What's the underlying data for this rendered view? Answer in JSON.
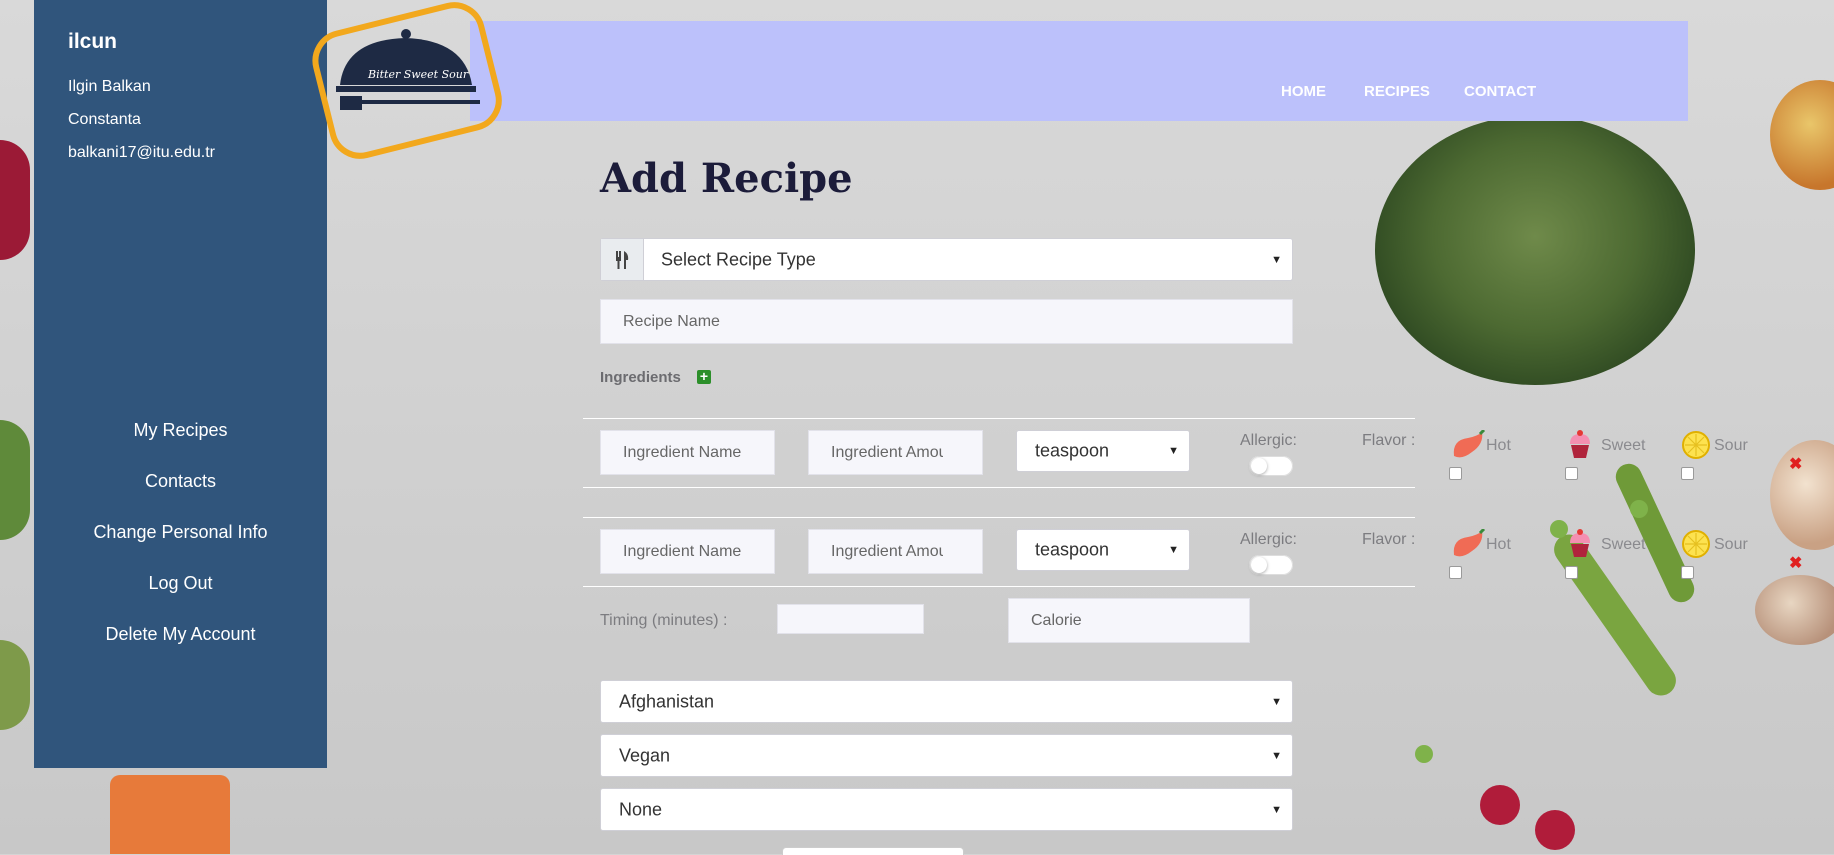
{
  "sidebar": {
    "username": "ilcun",
    "full_name": "Ilgin Balkan",
    "city": "Constanta",
    "email": "balkani17@itu.edu.tr",
    "menu": [
      "My Recipes",
      "Contacts",
      "Change Personal Info",
      "Log Out",
      "Delete My Account"
    ]
  },
  "header": {
    "logo_text": "Bitter Sweet Sour",
    "nav": [
      "HOME",
      "RECIPES",
      "CONTACT"
    ]
  },
  "form": {
    "title": "Add Recipe",
    "recipe_type": {
      "value": "Select Recipe Type",
      "icon": "fork-knife-icon"
    },
    "recipe_name_placeholder": "Recipe Name",
    "ingredients_label": "Ingredients",
    "ingredient_rows": [
      {
        "name_placeholder": "Ingredient Name",
        "amount_placeholder": "Ingredient Amou",
        "unit": "teaspoon",
        "allergic_label": "Allergic:",
        "flavor_label": "Flavor :",
        "flavors": [
          "Hot",
          "Sweet",
          "Sour"
        ]
      },
      {
        "name_placeholder": "Ingredient Name",
        "amount_placeholder": "Ingredient Amou",
        "unit": "teaspoon",
        "allergic_label": "Allergic:",
        "flavor_label": "Flavor :",
        "flavors": [
          "Hot",
          "Sweet",
          "Sour"
        ]
      }
    ],
    "timing_label": "Timing (minutes) :",
    "calorie_placeholder": "Calorie",
    "country": "Afghanistan",
    "diet": "Vegan",
    "extra": "None"
  },
  "colors": {
    "sidebar": "#30557c",
    "header": "#bcc1fb",
    "logo_ring": "#f2a81d",
    "add": "#2c8f2a",
    "remove": "#e02020"
  }
}
